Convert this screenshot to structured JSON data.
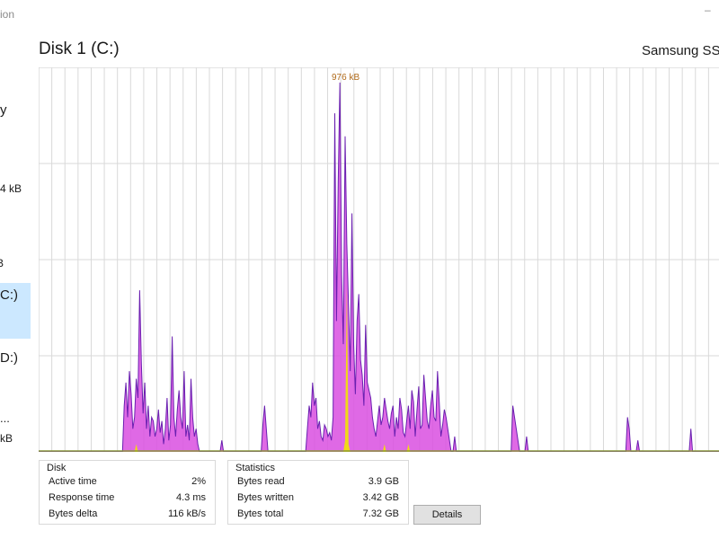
{
  "window": {
    "title_fragment": "ion",
    "control_fragment": "–"
  },
  "sidebar": {
    "fragments": [
      {
        "text": "y"
      },
      {
        "text": "4 kB"
      },
      {
        "text": "B"
      },
      {
        "text": "C:)"
      },
      {
        "text": "D:)"
      },
      {
        "text": "..."
      },
      {
        "text": "kB"
      }
    ],
    "selected_index": 3
  },
  "header": {
    "title": "Disk 1 (C:)",
    "model": "Samsung SS"
  },
  "graph": {
    "max_label": "976 kB",
    "series": [
      {
        "name": "write",
        "color": "#d94fe0"
      },
      {
        "name": "read",
        "color": "#f2e600"
      }
    ],
    "grid_color": "#d9d9d9",
    "line_color": "#6a1fb0"
  },
  "chart_data": {
    "type": "area",
    "title": "",
    "ylim": [
      0,
      976
    ],
    "y_unit": "kB",
    "series": [
      {
        "name": "",
        "values": [
          0,
          0,
          0,
          0,
          0,
          0,
          0,
          0,
          0,
          0,
          0,
          0,
          0,
          0,
          0,
          0,
          0,
          0,
          0,
          0,
          0,
          0,
          0,
          0,
          0,
          0,
          0,
          0,
          0,
          0,
          0,
          0,
          0,
          0,
          0,
          0,
          0,
          0,
          0,
          0,
          0,
          0,
          0,
          0,
          0,
          0,
          0,
          0,
          0,
          0,
          120,
          180,
          90,
          210,
          150,
          60,
          90,
          190,
          140,
          420,
          230,
          100,
          180,
          60,
          120,
          40,
          90,
          80,
          40,
          60,
          110,
          50,
          80,
          20,
          60,
          140,
          30,
          70,
          300,
          90,
          40,
          110,
          160,
          90,
          60,
          210,
          40,
          70,
          30,
          190,
          90,
          40,
          60,
          20,
          0,
          0,
          0,
          0,
          0,
          0,
          0,
          0,
          0,
          0,
          0,
          0,
          0,
          30,
          0,
          0,
          0,
          0,
          0,
          0,
          0,
          0,
          0,
          0,
          0,
          0,
          0,
          0,
          0,
          0,
          0,
          0,
          0,
          0,
          0,
          0,
          0,
          70,
          120,
          60,
          0,
          0,
          0,
          0,
          0,
          0,
          0,
          0,
          0,
          0,
          0,
          0,
          0,
          0,
          0,
          0,
          0,
          0,
          0,
          0,
          0,
          0,
          0,
          60,
          120,
          90,
          180,
          120,
          140,
          60,
          80,
          40,
          30,
          70,
          60,
          40,
          50,
          30,
          90,
          880,
          340,
          700,
          960,
          460,
          280,
          820,
          540,
          380,
          210,
          620,
          280,
          150,
          340,
          410,
          240,
          200,
          120,
          330,
          180,
          160,
          140,
          90,
          60,
          40,
          80,
          120,
          70,
          90,
          140,
          110,
          80,
          60,
          100,
          120,
          40,
          90,
          60,
          140,
          110,
          50,
          40,
          80,
          120,
          60,
          160,
          130,
          40,
          110,
          170,
          60,
          70,
          200,
          140,
          80,
          60,
          120,
          160,
          90,
          80,
          210,
          130,
          40,
          70,
          110,
          90,
          60,
          30,
          0,
          0,
          40,
          0,
          0,
          0,
          0,
          0,
          0,
          0,
          0,
          0,
          0,
          0,
          0,
          0,
          0,
          0,
          0,
          0,
          0,
          0,
          0,
          0,
          0,
          0,
          0,
          0,
          0,
          0,
          0,
          0,
          0,
          0,
          0,
          0,
          120,
          90,
          60,
          30,
          0,
          0,
          0,
          0,
          40,
          0,
          0,
          0,
          0,
          0,
          0,
          0,
          0,
          0,
          0,
          0,
          0,
          0,
          0,
          0,
          0,
          0,
          0,
          0,
          0,
          0,
          0,
          0,
          0,
          0,
          0,
          0,
          0,
          0,
          0,
          0,
          0,
          0,
          0,
          0,
          0,
          0,
          0,
          0,
          0,
          0,
          0,
          0,
          0,
          0,
          0,
          0,
          0,
          0,
          0,
          0,
          0,
          0,
          0,
          0,
          0,
          0,
          0,
          90,
          60,
          0,
          0,
          0,
          0,
          30,
          0,
          0,
          0,
          0,
          0,
          0,
          0,
          0,
          0,
          0,
          0,
          0,
          0,
          0,
          0,
          0,
          0,
          0,
          0,
          0,
          0,
          0,
          0,
          0,
          0,
          0,
          0,
          0,
          0,
          0,
          60,
          0,
          0,
          0,
          0,
          0,
          0,
          0,
          0,
          0,
          0,
          0,
          0,
          0,
          0,
          0,
          0,
          0,
          0
        ]
      },
      {
        "name": "",
        "values": [
          0,
          0,
          0,
          0,
          0,
          0,
          0,
          0,
          0,
          0,
          0,
          0,
          0,
          0,
          0,
          0,
          0,
          0,
          0,
          0,
          0,
          0,
          0,
          0,
          0,
          0,
          0,
          0,
          0,
          0,
          0,
          0,
          0,
          0,
          0,
          0,
          0,
          0,
          0,
          0,
          0,
          0,
          0,
          0,
          0,
          0,
          0,
          0,
          0,
          0,
          0,
          0,
          0,
          0,
          0,
          0,
          0,
          20,
          0,
          0,
          0,
          0,
          0,
          0,
          0,
          0,
          0,
          0,
          0,
          0,
          0,
          0,
          0,
          0,
          0,
          0,
          0,
          0,
          0,
          0,
          0,
          0,
          0,
          0,
          0,
          0,
          0,
          0,
          0,
          0,
          0,
          0,
          0,
          0,
          0,
          0,
          0,
          0,
          0,
          0,
          0,
          0,
          0,
          0,
          0,
          0,
          0,
          0,
          0,
          0,
          0,
          0,
          0,
          0,
          0,
          0,
          0,
          0,
          0,
          0,
          0,
          0,
          0,
          0,
          0,
          0,
          0,
          0,
          0,
          0,
          0,
          0,
          0,
          0,
          0,
          0,
          0,
          0,
          0,
          0,
          0,
          0,
          0,
          0,
          0,
          0,
          0,
          0,
          0,
          0,
          0,
          0,
          0,
          0,
          0,
          0,
          0,
          0,
          0,
          0,
          0,
          0,
          0,
          0,
          0,
          0,
          0,
          0,
          0,
          0,
          0,
          0,
          0,
          0,
          0,
          0,
          0,
          0,
          0,
          30,
          430,
          20,
          0,
          0,
          0,
          0,
          0,
          0,
          0,
          0,
          0,
          0,
          0,
          0,
          0,
          0,
          0,
          0,
          0,
          0,
          0,
          0,
          20,
          0,
          0,
          0,
          0,
          0,
          0,
          0,
          0,
          0,
          0,
          0,
          0,
          0,
          20,
          0,
          0,
          0,
          0,
          0,
          0,
          0,
          0,
          0,
          0,
          0,
          0,
          0,
          0,
          0,
          0,
          0,
          0,
          0,
          0,
          0,
          0,
          0,
          0,
          0,
          0,
          0,
          0,
          0,
          0,
          0,
          0,
          0,
          0,
          0,
          0,
          0,
          0,
          0,
          0,
          0,
          0,
          0,
          0,
          0,
          0,
          0,
          0,
          0,
          0,
          0,
          0,
          0,
          0,
          0,
          0,
          0,
          0,
          0,
          0,
          0,
          0,
          0,
          0,
          0,
          0,
          0,
          0,
          0,
          0,
          0,
          0,
          0,
          0,
          0,
          0,
          0,
          0,
          0,
          0,
          0,
          0,
          0,
          0,
          0,
          0,
          0,
          0,
          0,
          0,
          0,
          0,
          0,
          0,
          0,
          0,
          0,
          0,
          0,
          0,
          0,
          0,
          0,
          0,
          0,
          0,
          0,
          0,
          0,
          0,
          0,
          0,
          0,
          0,
          0,
          0,
          0,
          0,
          0,
          0,
          0,
          0,
          0,
          0,
          0,
          0,
          0,
          0,
          0,
          0,
          0,
          0,
          0,
          0,
          0,
          0,
          0,
          0,
          0,
          0,
          0,
          0,
          0,
          0,
          0,
          0,
          0,
          0,
          0,
          0,
          0,
          0,
          0,
          0,
          0,
          0,
          0,
          0,
          0,
          0,
          0,
          0,
          0,
          0,
          0,
          0,
          0,
          0,
          0,
          0,
          0,
          0,
          0,
          0,
          0,
          0,
          0,
          0,
          0,
          0,
          0,
          0,
          0
        ]
      }
    ],
    "grid": true
  },
  "disk_stats": {
    "title": "Disk",
    "rows": [
      {
        "label": "Active time",
        "value": "2%"
      },
      {
        "label": "Response time",
        "value": "4.3 ms"
      },
      {
        "label": "Bytes delta",
        "value": "116 kB/s"
      }
    ]
  },
  "statistics": {
    "title": "Statistics",
    "rows": [
      {
        "label": "Bytes read",
        "value": "3.9 GB"
      },
      {
        "label": "Bytes written",
        "value": "3.42 GB"
      },
      {
        "label": "Bytes total",
        "value": "7.32 GB"
      }
    ]
  },
  "details_button": {
    "label": "Details"
  }
}
